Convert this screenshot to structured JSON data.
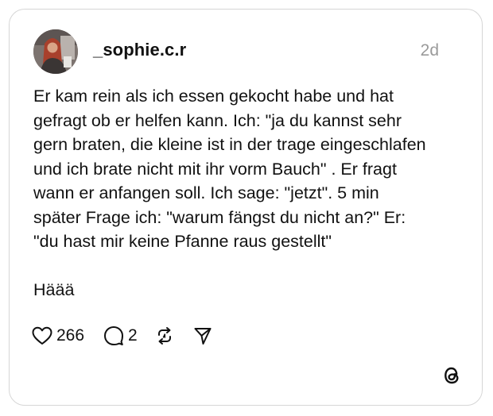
{
  "post": {
    "username": "_sophie.c.r",
    "timestamp": "2d",
    "text": "Er kam rein als ich essen gekocht habe und hat\ngefragt ob er helfen kann. Ich: \"ja du kannst sehr\ngern braten, die kleine ist in der trage eingeschlafen\nund ich brate nicht mit ihr vorm Bauch\" . Er fragt\nwann er anfangen soll. Ich sage: \"jetzt\". 5 min\nspäter Frage ich: \"warum fängst du nicht an?\" Er:\n\"du hast mir keine Pfanne raus gestellt\"\n\nHäää"
  },
  "actions": {
    "like_icon": "heart-icon",
    "like_count": "266",
    "reply_icon": "comment-icon",
    "reply_count": "2",
    "repost_icon": "repost-icon",
    "share_icon": "send-icon"
  },
  "branding": {
    "logo_icon": "threads-logo-icon"
  },
  "colors": {
    "text": "#111111",
    "muted": "#9a9a9a",
    "border": "#d6d6d6",
    "background": "#ffffff"
  }
}
